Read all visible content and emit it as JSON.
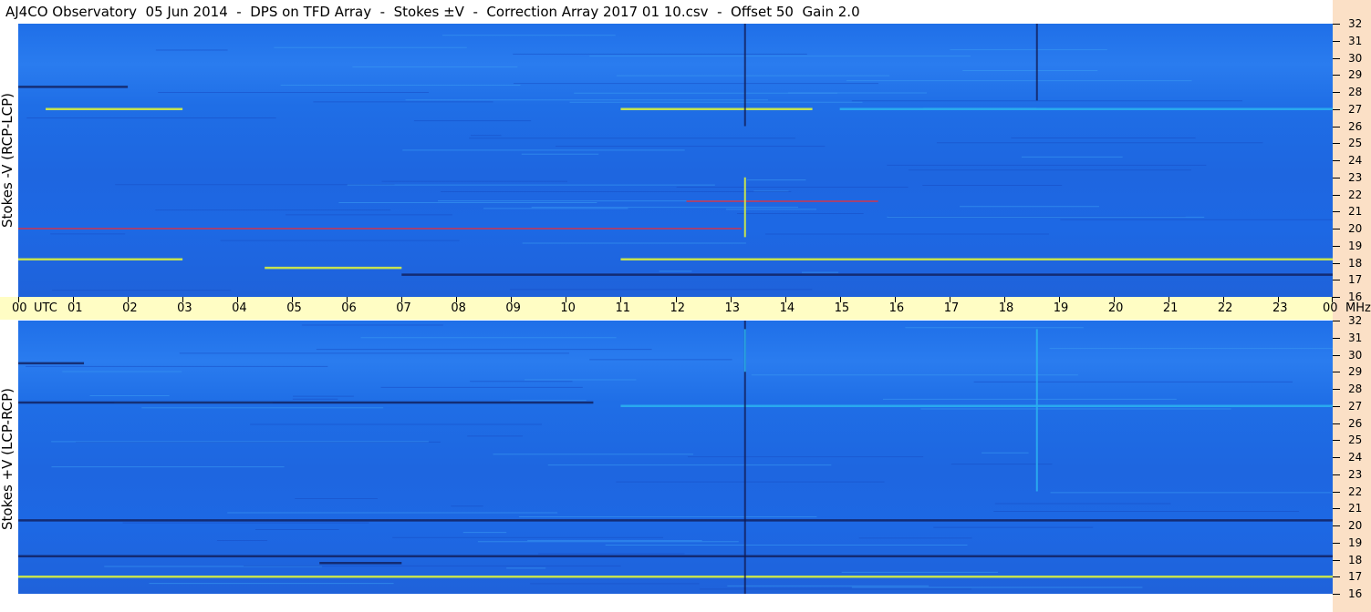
{
  "title": "AJ4CO Observatory  05 Jun 2014  -  DPS on TFD Array  -  Stokes ±V  -  Correction Array 2017 01 10.csv  -  Offset 50  Gain 2.0",
  "colors": {
    "background_low": "#1e3fd0",
    "background": "#1f6fe8",
    "mid": "#2bb0f0",
    "high": "#d8f040",
    "peak": "#e03040",
    "absorb": "#101850",
    "axis_band": "#fffdc4",
    "freq_strip": "#fbe0c6"
  },
  "chart_data": [
    {
      "type": "heatmap",
      "name": "top-panel",
      "ylabel": "Stokes -V (RCP-LCP)",
      "x_unit": "UTC",
      "y_unit": "MHz",
      "xlim_hours": [
        0,
        24
      ],
      "ylim_mhz": [
        16,
        32
      ],
      "time_ticks": [
        "00",
        "01",
        "02",
        "03",
        "04",
        "05",
        "06",
        "07",
        "08",
        "09",
        "10",
        "11",
        "12",
        "13",
        "14",
        "15",
        "16",
        "17",
        "18",
        "19",
        "20",
        "21",
        "22",
        "23",
        "00"
      ],
      "freq_ticks": [
        "32",
        "31",
        "30",
        "29",
        "28",
        "27",
        "26",
        "25",
        "24",
        "23",
        "22",
        "21",
        "20",
        "19",
        "18",
        "17",
        "16"
      ],
      "features": [
        {
          "kind": "band",
          "mhz": 28.3,
          "t_start": 0.0,
          "t_end": 2.0,
          "level": "low"
        },
        {
          "kind": "band",
          "mhz": 27.0,
          "t_start": 0.5,
          "t_end": 3.0,
          "level": "high"
        },
        {
          "kind": "band",
          "mhz": 27.0,
          "t_start": 11.0,
          "t_end": 14.5,
          "level": "high"
        },
        {
          "kind": "band",
          "mhz": 27.0,
          "t_start": 15.0,
          "t_end": 24.0,
          "level": "mid"
        },
        {
          "kind": "band",
          "mhz": 21.6,
          "t_start": 12.2,
          "t_end": 15.7,
          "level": "peak"
        },
        {
          "kind": "band",
          "mhz": 20.0,
          "t_start": 0.0,
          "t_end": 13.2,
          "level": "peak"
        },
        {
          "kind": "band",
          "mhz": 18.2,
          "t_start": 0.0,
          "t_end": 3.0,
          "level": "high"
        },
        {
          "kind": "band",
          "mhz": 18.2,
          "t_start": 11.0,
          "t_end": 24.0,
          "level": "high"
        },
        {
          "kind": "band",
          "mhz": 17.7,
          "t_start": 4.5,
          "t_end": 7.0,
          "level": "high"
        },
        {
          "kind": "band",
          "mhz": 17.3,
          "t_start": 7.0,
          "t_end": 24.0,
          "level": "low"
        },
        {
          "kind": "spike",
          "t": 13.27,
          "mhz_start": 19.5,
          "mhz_end": 23.0,
          "level": "high"
        },
        {
          "kind": "spike",
          "t": 13.27,
          "mhz_start": 26.0,
          "mhz_end": 32.0,
          "level": "low"
        },
        {
          "kind": "spike",
          "t": 18.6,
          "mhz_start": 27.5,
          "mhz_end": 32.0,
          "level": "low"
        }
      ]
    },
    {
      "type": "heatmap",
      "name": "bottom-panel",
      "ylabel": "Stokes +V (LCP-RCP)",
      "x_unit": "UTC",
      "y_unit": "MHz",
      "xlim_hours": [
        0,
        24
      ],
      "ylim_mhz": [
        16,
        32
      ],
      "time_ticks": [
        "00",
        "01",
        "02",
        "03",
        "04",
        "05",
        "06",
        "07",
        "08",
        "09",
        "10",
        "11",
        "12",
        "13",
        "14",
        "15",
        "16",
        "17",
        "18",
        "19",
        "20",
        "21",
        "22",
        "23",
        "00"
      ],
      "freq_ticks": [
        "32",
        "31",
        "30",
        "29",
        "28",
        "27",
        "26",
        "25",
        "24",
        "23",
        "22",
        "21",
        "20",
        "19",
        "18",
        "17",
        "16"
      ],
      "features": [
        {
          "kind": "band",
          "mhz": 29.5,
          "t_start": 0.0,
          "t_end": 1.2,
          "level": "low"
        },
        {
          "kind": "band",
          "mhz": 27.2,
          "t_start": 0.0,
          "t_end": 10.5,
          "level": "low"
        },
        {
          "kind": "band",
          "mhz": 27.0,
          "t_start": 11.0,
          "t_end": 24.0,
          "level": "mid"
        },
        {
          "kind": "band",
          "mhz": 20.3,
          "t_start": 0.0,
          "t_end": 24.0,
          "level": "low"
        },
        {
          "kind": "band",
          "mhz": 18.2,
          "t_start": 0.0,
          "t_end": 24.0,
          "level": "low"
        },
        {
          "kind": "band",
          "mhz": 17.8,
          "t_start": 5.5,
          "t_end": 7.0,
          "level": "low"
        },
        {
          "kind": "band",
          "mhz": 17.0,
          "t_start": 0.0,
          "t_end": 24.0,
          "level": "high"
        },
        {
          "kind": "spike",
          "t": 13.27,
          "mhz_start": 16.0,
          "mhz_end": 32.0,
          "level": "low"
        },
        {
          "kind": "spike",
          "t": 13.27,
          "mhz_start": 29.0,
          "mhz_end": 31.5,
          "level": "mid"
        },
        {
          "kind": "spike",
          "t": 18.6,
          "mhz_start": 22.0,
          "mhz_end": 31.5,
          "level": "mid"
        }
      ]
    }
  ],
  "axis": {
    "utc_label": "UTC",
    "mhz_label": "MHz"
  }
}
